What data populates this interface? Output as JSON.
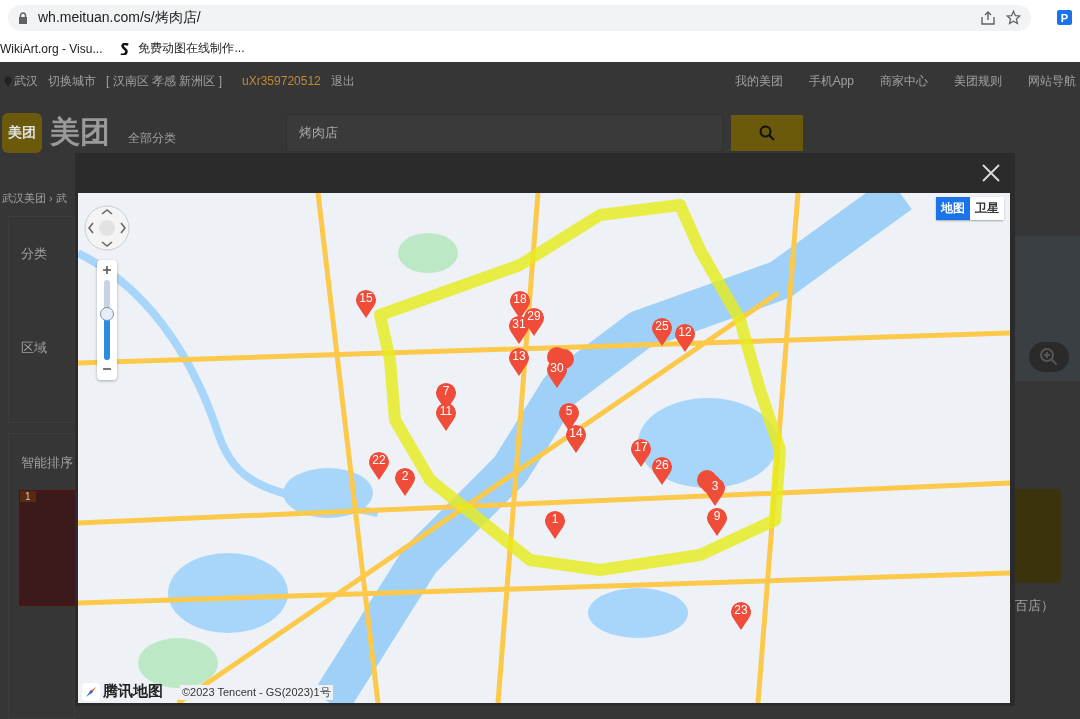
{
  "browser": {
    "url": "wh.meituan.com/s/烤肉店/",
    "extension": "P",
    "bookmarks": [
      {
        "label": "WikiArt.org - Visu..."
      },
      {
        "label": "免费动图在线制作..."
      }
    ]
  },
  "site": {
    "city": "武汉",
    "switch_city": "切换城市",
    "nearby": "[ 汉南区  孝感  新洲区 ]",
    "user": "uXr359720512",
    "logout": "退出",
    "nav_right": [
      "我的美团",
      "手机App",
      "商家中心",
      "美团规则",
      "网站导航"
    ],
    "logo_badge": "美团",
    "logo_text": "美团",
    "category": "全部分类",
    "search_value": "烤肉店",
    "breadcrumb": "武汉美团 › 武",
    "filters": [
      "分类",
      "区域"
    ],
    "sort": "智能排序",
    "rank_badge": "1",
    "shop_text": "百店）"
  },
  "map_dialog": {
    "map_types": [
      {
        "label": "地图",
        "selected": true
      },
      {
        "label": "卫星",
        "selected": false
      }
    ],
    "zoom": {
      "level": 0.58
    },
    "logo": "腾讯地图",
    "copyright": "©2023 Tencent - GS(2023)1号",
    "markers": [
      {
        "label": "15"
      },
      {
        "label": "18"
      },
      {
        "label": "29"
      },
      {
        "label": "31"
      },
      {
        "label": "13"
      },
      {
        "label": "30"
      },
      {
        "label": "25"
      },
      {
        "label": "12"
      },
      {
        "label": "7"
      },
      {
        "label": "11"
      },
      {
        "label": "5"
      },
      {
        "label": "14"
      },
      {
        "label": "17"
      },
      {
        "label": "26"
      },
      {
        "label": "22"
      },
      {
        "label": "2"
      },
      {
        "label": "3"
      },
      {
        "label": "9"
      },
      {
        "label": "1"
      },
      {
        "label": "23"
      }
    ]
  }
}
